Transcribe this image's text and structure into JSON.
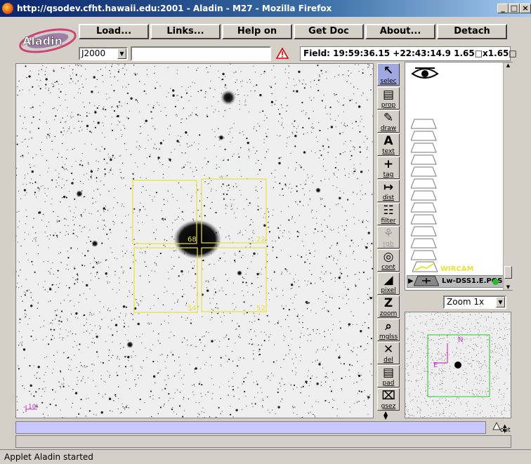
{
  "window": {
    "title": "http://qsodev.cfht.hawaii.edu:2001 - Aladin - M27 - Mozilla Firefox"
  },
  "logo": {
    "text": "Aladin"
  },
  "menu": [
    {
      "label": "Load..."
    },
    {
      "label": "Links..."
    },
    {
      "label": "Help on"
    },
    {
      "label": "Get Doc"
    },
    {
      "label": "About..."
    },
    {
      "label": "Detach"
    }
  ],
  "frame": {
    "selected": "J2000"
  },
  "command": {
    "value": ""
  },
  "field_info": "Field: 19:59:36.15 +22:43:14.9   1.65□x1.65□",
  "tools": [
    {
      "label": "selec",
      "glyph": "↖",
      "active": true
    },
    {
      "label": "prop",
      "glyph": "▤"
    },
    {
      "label": "draw",
      "glyph": "✎"
    },
    {
      "label": "text",
      "glyph": "A"
    },
    {
      "label": "tag",
      "glyph": "+"
    },
    {
      "label": "dist",
      "glyph": "↦"
    },
    {
      "label": "filter",
      "glyph": "☷"
    },
    {
      "label": "rgb",
      "glyph": "⚘",
      "dim": true
    },
    {
      "label": "cont",
      "glyph": "◎"
    },
    {
      "label": "pixel",
      "glyph": "◢"
    },
    {
      "label": "zoom",
      "glyph": "Z"
    },
    {
      "label": "mglss",
      "glyph": "⌕"
    },
    {
      "label": "del",
      "glyph": "✕"
    },
    {
      "label": "pad",
      "glyph": "▤"
    },
    {
      "label": "gsez",
      "glyph": "⌧"
    }
  ],
  "planes": {
    "wircam_label": "WIRCAM",
    "image_label": "Lw-DSS1.E.POS"
  },
  "overlay": {
    "chips": [
      "68",
      "",
      "22",
      "54",
      "52"
    ],
    "scale_label": "10'"
  },
  "zoom": {
    "selected": "Zoom 1x"
  },
  "zoomview": {
    "north": "N",
    "east": "E"
  },
  "out_label": "out",
  "status": {
    "text": "Applet Aladin started"
  },
  "colors": {
    "overlay": "#e8e23a",
    "compass": "#cc33cc",
    "zoombox": "#22cc22",
    "tool_active": "#9fa8e0"
  }
}
